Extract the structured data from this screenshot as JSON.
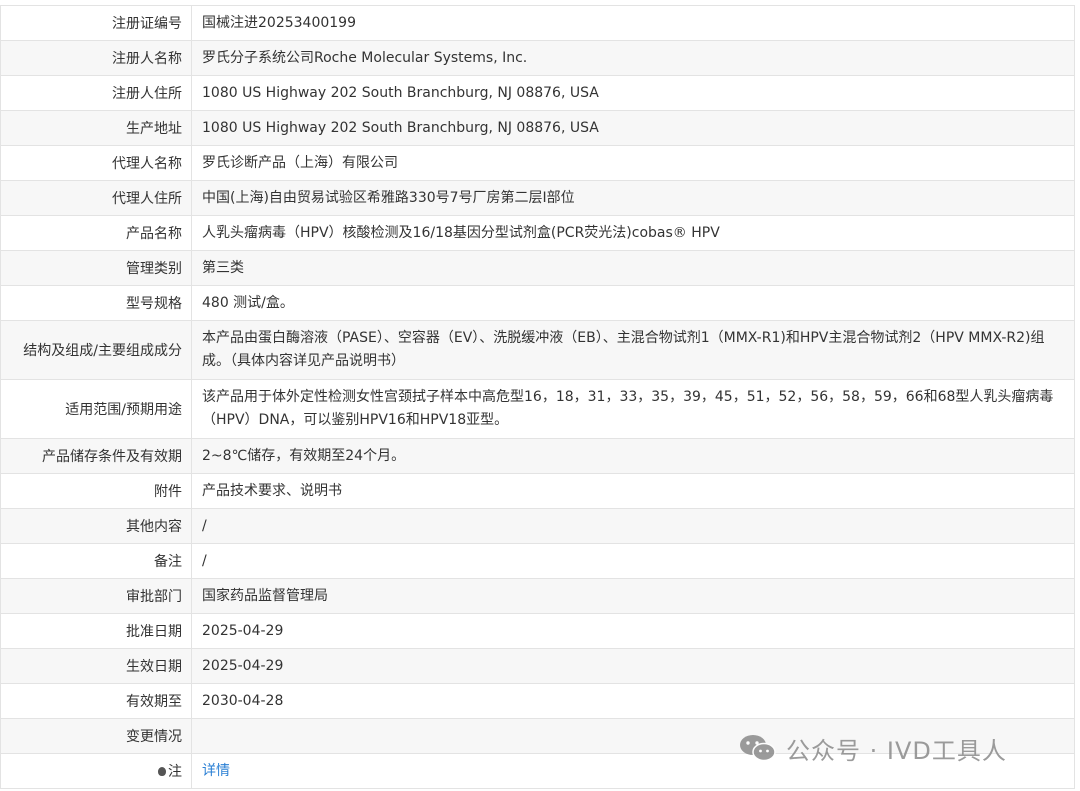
{
  "rows": [
    {
      "label": "注册证编号",
      "value": "国械注进20253400199"
    },
    {
      "label": "注册人名称",
      "value": "罗氏分子系统公司Roche Molecular Systems, Inc."
    },
    {
      "label": "注册人住所",
      "value": "1080 US Highway 202 South Branchburg, NJ 08876, USA"
    },
    {
      "label": "生产地址",
      "value": "1080 US Highway 202 South Branchburg, NJ 08876, USA"
    },
    {
      "label": "代理人名称",
      "value": "罗氏诊断产品（上海）有限公司"
    },
    {
      "label": "代理人住所",
      "value": "中国(上海)自由贸易试验区希雅路330号7号厂房第二层I部位"
    },
    {
      "label": "产品名称",
      "value": "人乳头瘤病毒（HPV）核酸检测及16/18基因分型试剂盒(PCR荧光法)cobas® HPV"
    },
    {
      "label": "管理类别",
      "value": "第三类"
    },
    {
      "label": "型号规格",
      "value": "480 测试/盒。"
    },
    {
      "label": "结构及组成/主要组成成分",
      "value": "本产品由蛋白酶溶液（PASE）、空容器（EV）、洗脱缓冲液（EB）、主混合物试剂1（MMX-R1)和HPV主混合物试剂2（HPV MMX-R2)组成。（具体内容详见产品说明书）"
    },
    {
      "label": "适用范围/预期用途",
      "value": "该产品用于体外定性检测女性宫颈拭子样本中高危型16，18，31，33，35，39，45，51，52，56，58，59，66和68型人乳头瘤病毒（HPV）DNA，可以鉴别HPV16和HPV18亚型。"
    },
    {
      "label": "产品储存条件及有效期",
      "value": "2~8℃储存，有效期至24个月。"
    },
    {
      "label": "附件",
      "value": "产品技术要求、说明书"
    },
    {
      "label": "其他内容",
      "value": "/"
    },
    {
      "label": "备注",
      "value": "/"
    },
    {
      "label": "审批部门",
      "value": "国家药品监督管理局"
    },
    {
      "label": "批准日期",
      "value": "2025-04-29"
    },
    {
      "label": "生效日期",
      "value": "2025-04-29"
    },
    {
      "label": "有效期至",
      "value": "2030-04-28"
    },
    {
      "label": "变更情况",
      "value": ""
    }
  ],
  "note_row": {
    "label": "注",
    "link": "详情"
  },
  "watermark": {
    "text": "公众号 · IVD工具人",
    "icon": "wechat-icon"
  },
  "colors": {
    "link": "#2a7fd4",
    "alt_row": "#f7f7f7",
    "border": "#e3e3e3"
  }
}
